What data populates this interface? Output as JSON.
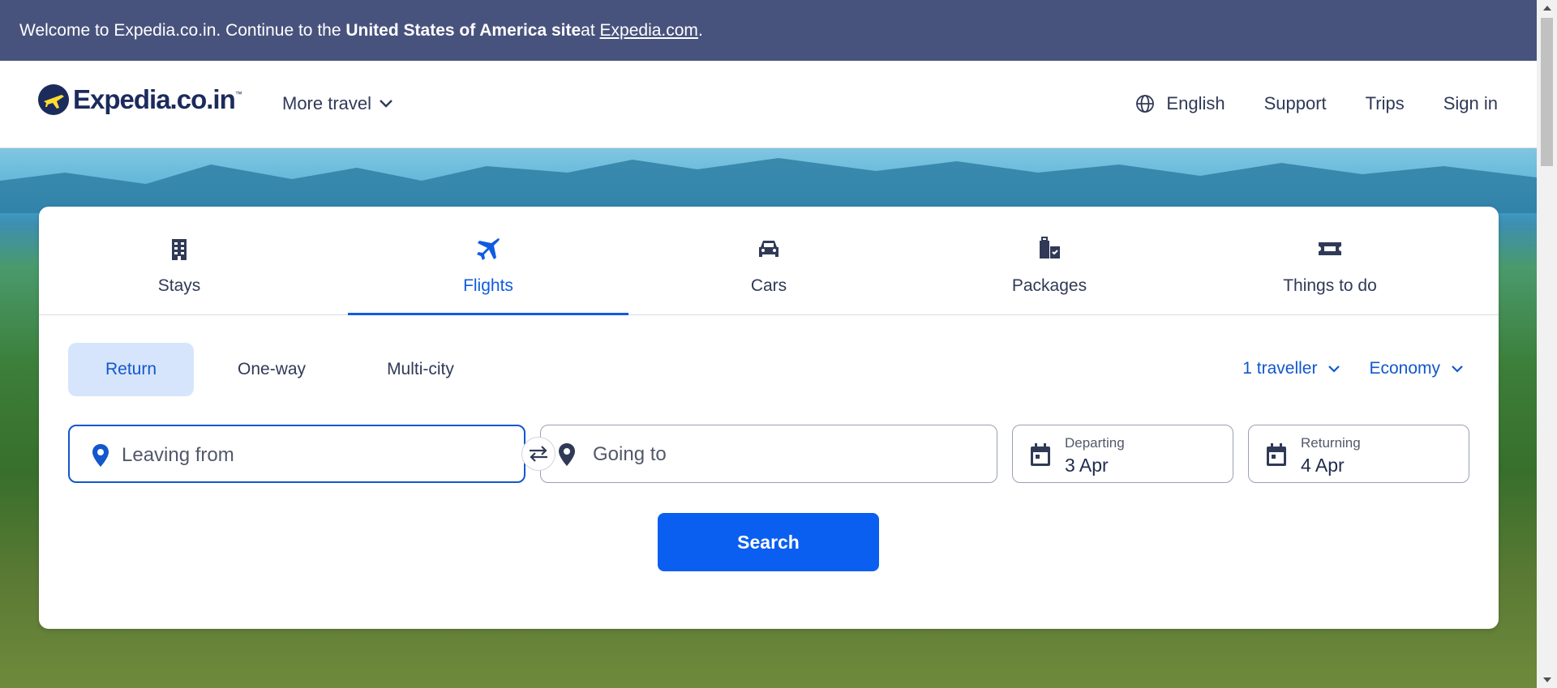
{
  "banner": {
    "text_prefix": "Welcome to Expedia.co.in. Continue to the ",
    "text_bold": "United States of America site",
    "text_mid": " at ",
    "link": "Expedia.com",
    "text_suffix": "."
  },
  "header": {
    "logo_text": "Expedia.co.in",
    "logo_tm": "™",
    "more_travel": "More travel",
    "language": "English",
    "support": "Support",
    "trips": "Trips",
    "sign_in": "Sign in"
  },
  "tabs": [
    {
      "label": "Stays",
      "icon": "building-icon"
    },
    {
      "label": "Flights",
      "icon": "plane-icon",
      "active": true
    },
    {
      "label": "Cars",
      "icon": "car-icon"
    },
    {
      "label": "Packages",
      "icon": "luggage-icon"
    },
    {
      "label": "Things to do",
      "icon": "ticket-icon"
    }
  ],
  "trip_types": [
    {
      "label": "Return",
      "active": true
    },
    {
      "label": "One-way"
    },
    {
      "label": "Multi-city"
    }
  ],
  "selectors": {
    "travellers": "1 traveller",
    "cabin": "Economy"
  },
  "fields": {
    "leaving_from": "Leaving from",
    "going_to": "Going to",
    "departing_label": "Departing",
    "departing_value": "3 Apr",
    "returning_label": "Returning",
    "returning_value": "4 Apr"
  },
  "search_label": "Search",
  "colors": {
    "banner_bg": "#48537d",
    "accent": "#0f5ce0",
    "search_bg": "#0a5ff0",
    "trip_active_bg": "#d6e5fb"
  }
}
